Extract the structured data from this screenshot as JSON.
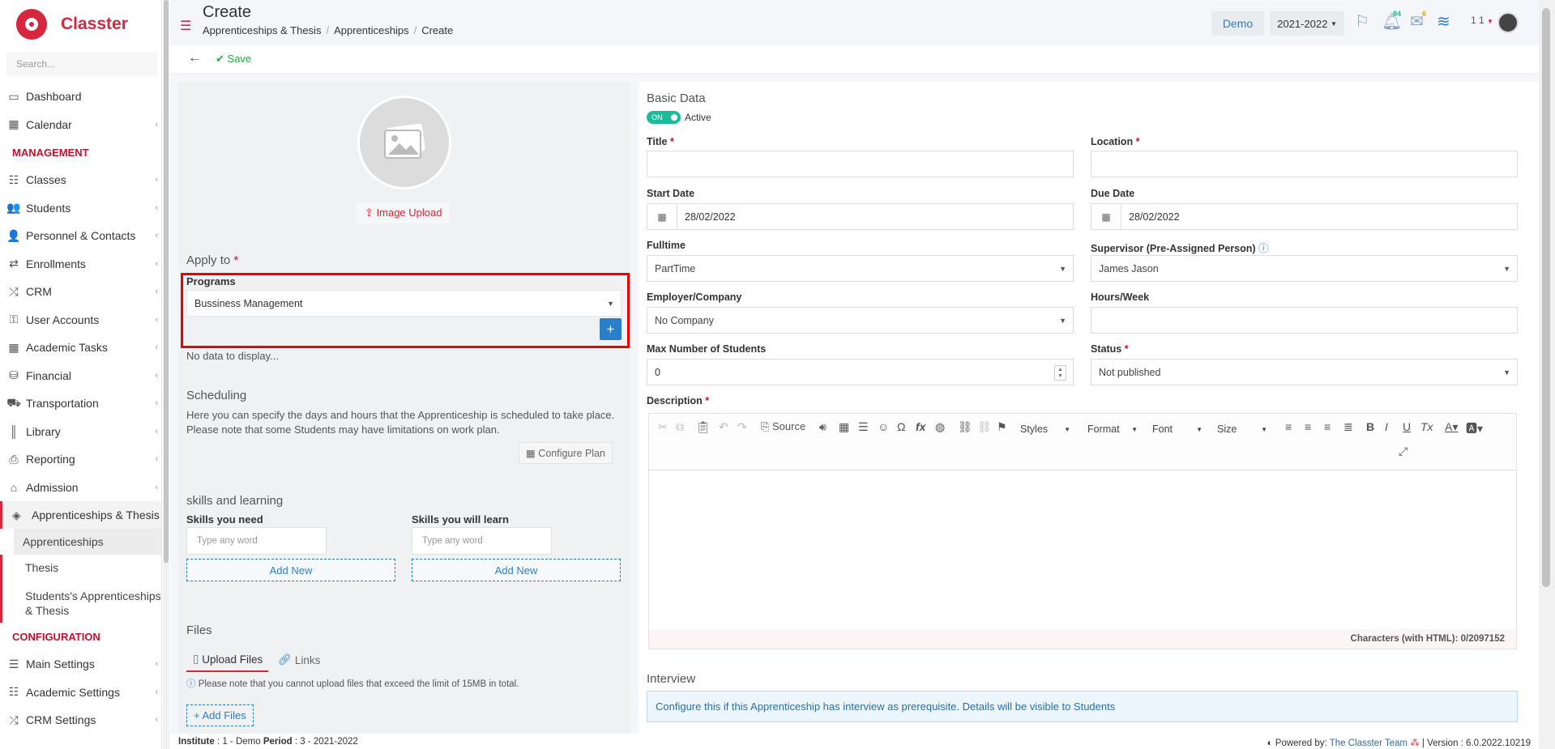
{
  "app": {
    "name": "Classter"
  },
  "sidebar": {
    "search_placeholder": "Search...",
    "items_top": [
      {
        "label": "Dashboard",
        "icon": "laptop-icon"
      },
      {
        "label": "Calendar",
        "icon": "calendar-icon"
      }
    ],
    "management_label": "MANAGEMENT",
    "items_mgmt": [
      {
        "label": "Classes",
        "icon": "classes-icon"
      },
      {
        "label": "Students",
        "icon": "users-icon"
      },
      {
        "label": "Personnel & Contacts",
        "icon": "person-icon"
      },
      {
        "label": "Enrollments",
        "icon": "exchange-icon"
      },
      {
        "label": "CRM",
        "icon": "crm-icon"
      },
      {
        "label": "User Accounts",
        "icon": "key-icon"
      },
      {
        "label": "Academic Tasks",
        "icon": "grid-icon"
      },
      {
        "label": "Financial",
        "icon": "coins-icon"
      },
      {
        "label": "Transportation",
        "icon": "bus-icon"
      },
      {
        "label": "Library",
        "icon": "books-icon"
      },
      {
        "label": "Reporting",
        "icon": "printer-icon"
      },
      {
        "label": "Admission",
        "icon": "building-icon"
      }
    ],
    "active_parent": "Apprenticeships & Thesis",
    "sub_items": [
      "Apprenticeships",
      "Thesis",
      "Students's Apprenticeships & Thesis"
    ],
    "configuration_label": "CONFIGURATION",
    "items_config": [
      {
        "label": "Main Settings",
        "icon": "sliders-icon"
      },
      {
        "label": "Academic Settings",
        "icon": "classes-icon"
      },
      {
        "label": "CRM Settings",
        "icon": "crm-icon"
      }
    ]
  },
  "header": {
    "title": "Create",
    "breadcrumb": [
      "Apprenticeships & Thesis",
      "Apprenticeships",
      "Create"
    ],
    "demo_label": "Demo",
    "year": "2021-2022",
    "notifications_count": "84",
    "messages_count": "6",
    "user_short": "1 1"
  },
  "toolbar": {
    "save_label": "Save"
  },
  "left": {
    "image_upload_label": "Image Upload",
    "apply_to_label": "Apply to",
    "programs_label": "Programs",
    "programs_value": "Bussiness Management",
    "no_data": "No data to display...",
    "scheduling_title": "Scheduling",
    "scheduling_text": "Here you can specify the days and hours that the Apprenticeship is scheduled to take place. Please note that some Students may have limitations on work plan.",
    "configure_plan": "Configure Plan",
    "skills_title": "skills and learning",
    "skills_need": "Skills you need",
    "skills_learn": "Skills you will learn",
    "word_placeholder": "Type any word",
    "add_new": "Add New",
    "files_title": "Files",
    "tab_upload": "Upload Files",
    "tab_links": "Links",
    "files_note": "Please note that you cannot upload files that exceed the limit of 15MB in total.",
    "add_files": "Add Files"
  },
  "form": {
    "basic_title": "Basic Data",
    "toggle_on": "ON",
    "active_label": "Active",
    "title_label": "Title",
    "location_label": "Location",
    "start_date_label": "Start Date",
    "start_date": "28/02/2022",
    "due_date_label": "Due Date",
    "due_date": "28/02/2022",
    "fulltime_label": "Fulltime",
    "fulltime_value": "PartTime",
    "supervisor_label": "Supervisor (Pre-Assigned Person)",
    "supervisor_value": "James Jason",
    "employer_label": "Employer/Company",
    "employer_value": "No Company",
    "hours_label": "Hours/Week",
    "max_students_label": "Max Number of Students",
    "max_students_value": "0",
    "status_label": "Status",
    "status_value": "Not published",
    "description_label": "Description",
    "editor": {
      "source": "Source",
      "styles": "Styles",
      "format": "Format",
      "font": "Font",
      "size": "Size",
      "chars": "Characters (with HTML): 0/2097152"
    },
    "interview_title": "Interview",
    "interview_text": "Configure this if this Apprenticeship has interview as prerequisite. Details will be visible to Students"
  },
  "footer": {
    "institute_label": "Institute",
    "institute_value": ": 1 - Demo",
    "period_label": "Period",
    "period_value": ": 3 - 2021-2022",
    "powered_by": "Powered by:",
    "team": "The Classter Team",
    "version": "| Version : 6.0.2022.10219"
  },
  "colors": {
    "brand": "#d7263d",
    "accent_blue": "#2b7fc8",
    "success": "#28a745"
  }
}
